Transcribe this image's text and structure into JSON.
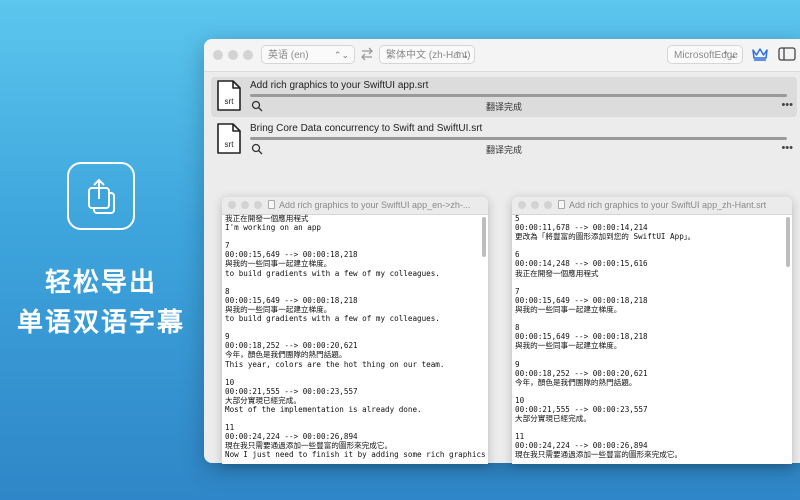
{
  "promo": {
    "line1": "轻松导出",
    "line2": "单语双语字幕"
  },
  "toolbar": {
    "source_language": "英语 (en)",
    "target_language": "繁体中文 (zh-Hant)",
    "engine": "MicrosoftEdge"
  },
  "files": [
    {
      "icon_label": "srt",
      "name": "Add rich graphics to your SwiftUI app.srt",
      "status": "翻译完成",
      "progress": 100
    },
    {
      "icon_label": "srt",
      "name": "Bring Core Data concurrency to Swift and SwiftUI.srt",
      "status": "翻译完成",
      "progress": 100
    }
  ],
  "preview_left": {
    "title": "Add rich graphics to your SwiftUI app_en->zh-...",
    "blocks": [
      [
        "我正在開發一個應用程式",
        "I'm working on an app"
      ],
      [
        "7",
        "00:00:15,649 --> 00:00:18,218",
        "與我的一些同事一起建立梯度。",
        "to build gradients with a few of my colleagues."
      ],
      [
        "8",
        "00:00:15,649 --> 00:00:18,218",
        "與我的一些同事一起建立梯度。",
        "to build gradients with a few of my colleagues."
      ],
      [
        "9",
        "00:00:18,252 --> 00:00:20,621",
        "今年，顏色是我們團隊的熱門話題。",
        "This year, colors are the hot thing on our team."
      ],
      [
        "10",
        "00:00:21,555 --> 00:00:23,557",
        "大部分實現已經完成。",
        "Most of the implementation is already done."
      ],
      [
        "11",
        "00:00:24,224 --> 00:00:26,894",
        "現在我只需要通過添加一些豐富的圖形來完成它。",
        "Now I just need to finish it by adding some rich graphics."
      ]
    ]
  },
  "preview_right": {
    "title": "Add rich graphics to your SwiftUI app_zh-Hant.srt",
    "blocks": [
      [
        "5",
        "00:00:11,678 --> 00:00:14,214",
        "更改為「將豐富的圖形添加到您的 SwiftUI App」。"
      ],
      [
        "6",
        "00:00:14,248 --> 00:00:15,616",
        "我正在開發一個應用程式"
      ],
      [
        "7",
        "00:00:15,649 --> 00:00:18,218",
        "與我的一些同事一起建立梯度。"
      ],
      [
        "8",
        "00:00:15,649 --> 00:00:18,218",
        "與我的一些同事一起建立梯度。"
      ],
      [
        "9",
        "00:00:18,252 --> 00:00:20,621",
        "今年，顏色是我們團隊的熱門話題。"
      ],
      [
        "10",
        "00:00:21,555 --> 00:00:23,557",
        "大部分實現已經完成。"
      ],
      [
        "11",
        "00:00:24,224 --> 00:00:26,894",
        "現在我只需要通過添加一些豐富的圖形來完成它。"
      ]
    ]
  }
}
